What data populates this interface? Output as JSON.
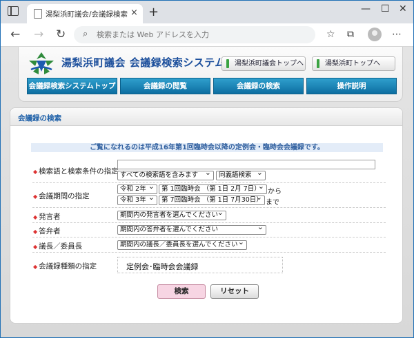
{
  "browser": {
    "tab_title": "湯梨浜町議会/会議録検索システム",
    "tab_close": "×",
    "new_tab": "+",
    "address_placeholder": "検索または Web アドレスを入力"
  },
  "header": {
    "site_title": "湯梨浜町議会 会議録検索システム",
    "link_council_top": "湯梨浜町議会トップへ",
    "link_town_top": "湯梨浜町トップへ"
  },
  "nav": {
    "items": [
      "会議録検索システムトップ",
      "会議録の閲覧",
      "会議録の検索",
      "操作説明"
    ]
  },
  "section": {
    "title": "会議録の検索",
    "notice": "ご覧になれるのは平成16年第1回臨時会以降の定例会・臨時会会議録です。"
  },
  "form": {
    "keyword_label": "検索語と検索条件の指定",
    "keyword_value": "",
    "keyword_mode": "すべての検索語を含みます",
    "synonym_mode": "同義語検索",
    "period_label": "会議期間の指定",
    "from_year": "令和 2年",
    "from_meeting": "第 1回臨時会 （第 1日 2月 7日）",
    "from_suffix": "から",
    "to_year": "令和 3年",
    "to_meeting": "第 7回臨時会 （第 1日 7月30日）",
    "to_suffix": "まで",
    "speaker_label": "発言者",
    "speaker_value": "期間内の発言者を選んでください",
    "answerer_label": "答弁者",
    "answerer_value": "期間内の答弁者を選んでください",
    "chair_label": "議長／委員長",
    "chair_value": "期間内の議長／委員長を選んでください",
    "type_label": "会議録種類の指定",
    "type_value": "定例会･臨時会会議録"
  },
  "buttons": {
    "search": "検索",
    "reset": "リセット"
  },
  "colors": {
    "nav_blue": "#1680b8",
    "title_blue": "#1c4f9c",
    "search_pink": "#f7d5e3"
  }
}
